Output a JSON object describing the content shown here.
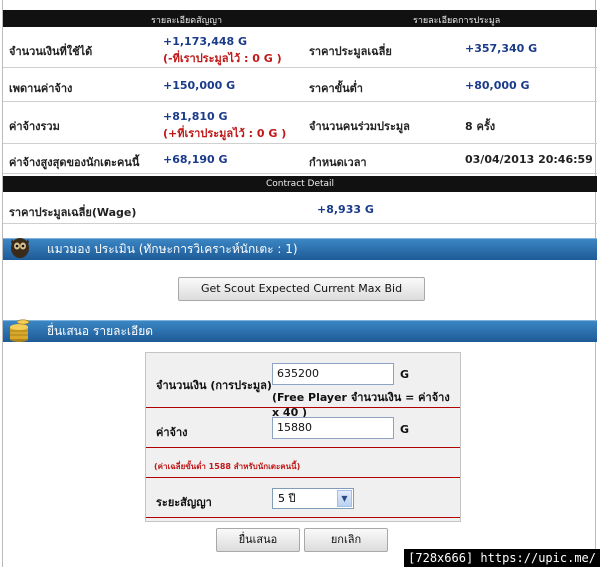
{
  "header": {
    "left_title": "รายละเอียดสัญญา",
    "right_title": "รายละเอียดการประมูล"
  },
  "rows": [
    {
      "left_label": "จำนวนเงินที่ใช้ได้",
      "left_value": "+1,173,448 G",
      "left_note": "(-ที่เราประมูลไว้ : 0 G )",
      "right_label": "ราคาประมูลเฉลี่ย",
      "right_value": "+357,340 G"
    },
    {
      "left_label": "เพดานค่าจ้าง",
      "left_value": "+150,000 G",
      "right_label": "ราคาขั้นต่ำ",
      "right_value": "+80,000 G"
    },
    {
      "left_label": "ค่าจ้างรวม",
      "left_value": "+81,810 G",
      "left_note": "(+ที่เราประมูลไว้ : 0 G )",
      "right_label": "จำนวนคนร่วมประมูล",
      "right_value": "8 ครั้ง"
    },
    {
      "left_label": "ค่าจ้างสูงสุดของนักเตะคนนี้",
      "left_value": "+68,190 G",
      "right_label": "กำหนดเวลา",
      "right_value": "03/04/2013 20:46:59"
    }
  ],
  "contract": {
    "title": "Contract Detail",
    "label": "ราคาประมูลเฉลี่ย(Wage)",
    "value": "+8,933 G"
  },
  "scout": {
    "title": "แมวมอง ประเมิน (ทักษะการวิเคราะห์นักเตะ : 1)",
    "button": "Get Scout Expected Current Max Bid"
  },
  "bid": {
    "title": "ยื่นเสนอ รายละเอียด",
    "amount_label": "จำนวนเงิน (การประมูล)",
    "amount_value": "635200",
    "amount_unit": "G",
    "amount_hint": "(Free Player จำนวนเงิน = ค่าจ้าง x 40 )",
    "wage_label": "ค่าจ้าง",
    "wage_value": "15880",
    "wage_unit": "G",
    "wage_warning": "(ค่าเฉลี่ยขั้นต่ำ 1588 สำหรับนักเตะคนนี้)",
    "term_label": "ระยะสัญญา",
    "term_value": "5 ปี",
    "submit": "ยื่นเสนอ",
    "cancel": "ยกเลิก"
  },
  "watermark": "[728x666] https://upic.me/"
}
